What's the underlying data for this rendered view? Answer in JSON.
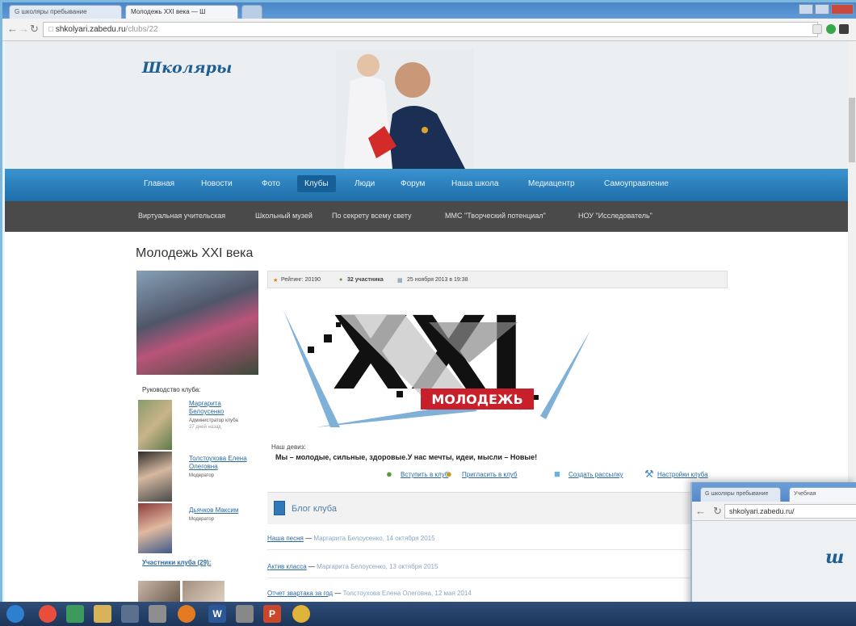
{
  "browser": {
    "tabs": [
      {
        "label": "G школяры пребывание"
      },
      {
        "label": "Молодежь XXI века — Ш"
      }
    ],
    "url_host": "shkolyari.zabedu.ru",
    "url_path": "/clubs/22"
  },
  "site": {
    "logo_text": "Школяры"
  },
  "main_menu": [
    "Главная",
    "Новости",
    "Фото",
    "Клубы",
    "Люди",
    "Форум",
    "Наша школа",
    "Медиацентр",
    "Самоуправление"
  ],
  "sub_menu": [
    "Виртуальная учительская",
    "Школьный музей",
    "По секрету всему свету",
    "ММС \"Творческий потенциал\"",
    "НОУ \"Исследователь\""
  ],
  "club": {
    "title": "Молодежь XXI века",
    "leadership_label": "Руководство клуба:",
    "leaders": [
      {
        "name": "Маргарита Белоусенко",
        "role": "Администратор клуба",
        "extra": "27 дней назад"
      },
      {
        "name": "Толстоухова Елена Олеговна",
        "role": "Модератор"
      },
      {
        "name": "Дьячков Максим",
        "role": "Модератор"
      }
    ],
    "members_label": "Участники клуба (29):",
    "info": {
      "rating": "Рейтинг: 20190",
      "participants": "32 участника",
      "date": "25 ноября 2013 в 19:38"
    },
    "banner_text": "МОЛОДЕЖЬ",
    "banner_big": "XXI",
    "motto_label": "Наш девиз:",
    "motto": "Мы – молодые, сильные, здоровые.У нас мечты, идеи, мысли – Новые!",
    "actions": [
      "Вступить в клуб",
      "Пригласить в клуб",
      "Создать рассылку",
      "Настройки клуба"
    ]
  },
  "blog": {
    "title": "Блог клуба",
    "posts": [
      {
        "title": "Наша песня",
        "meta": "Маргарита Белоусенко, 14 октября 2015"
      },
      {
        "title": "Актив класса",
        "meta": "Маргарита Белоусенко, 13 октября 2015"
      },
      {
        "title": "Отчет звартака за год",
        "meta": "Толстоухова Елена Олеговна, 12 мая 2014"
      }
    ]
  },
  "overlay": {
    "tabs": [
      {
        "label": "G школяры пребывание"
      },
      {
        "label": "Учебная"
      }
    ],
    "url": "shkolyari.zabedu.ru/"
  },
  "colors": {
    "accent": "#1e6ea9",
    "submenu": "#4a4a4a",
    "link": "#2a6aa3"
  }
}
